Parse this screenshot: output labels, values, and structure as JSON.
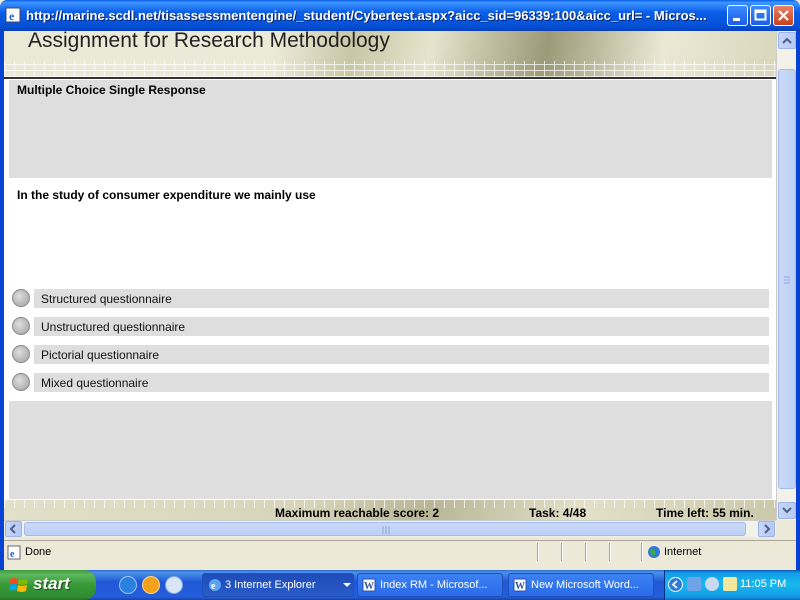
{
  "window": {
    "title": "http://marine.scdl.net/tisassessmentengine/_student/Cybertest.aspx?aicc_sid=96339:100&aicc_url= - Micros..."
  },
  "page": {
    "banner_title": "Assignment for Research Methodology",
    "question_type": "Multiple Choice Single Response",
    "question": "In the study of consumer expenditure we mainly use",
    "options": [
      {
        "label": "Structured questionnaire",
        "selected": false
      },
      {
        "label": "Unstructured questionnaire",
        "selected": false
      },
      {
        "label": "Pictorial questionnaire",
        "selected": false
      },
      {
        "label": "Mixed questionnaire",
        "selected": false
      }
    ],
    "footer": {
      "score": "Maximum reachable score: 2",
      "task": "Task: 4/48",
      "time": "Time left: 55 min."
    }
  },
  "statusbar": {
    "status": "Done",
    "zone": "Internet"
  },
  "taskbar": {
    "start_label": "start",
    "items": [
      {
        "label": "3 Internet Explorer",
        "icon": "ie-icon"
      },
      {
        "label": "Index RM - Microsof...",
        "icon": "word-icon"
      },
      {
        "label": "New Microsoft Word...",
        "icon": "word-icon"
      }
    ],
    "clock": "11:05 PM"
  },
  "colors": {
    "titlebar": "#0a5de8",
    "panel_gray": "#dedede",
    "taskbar": "#245edb",
    "start": "#379937"
  }
}
